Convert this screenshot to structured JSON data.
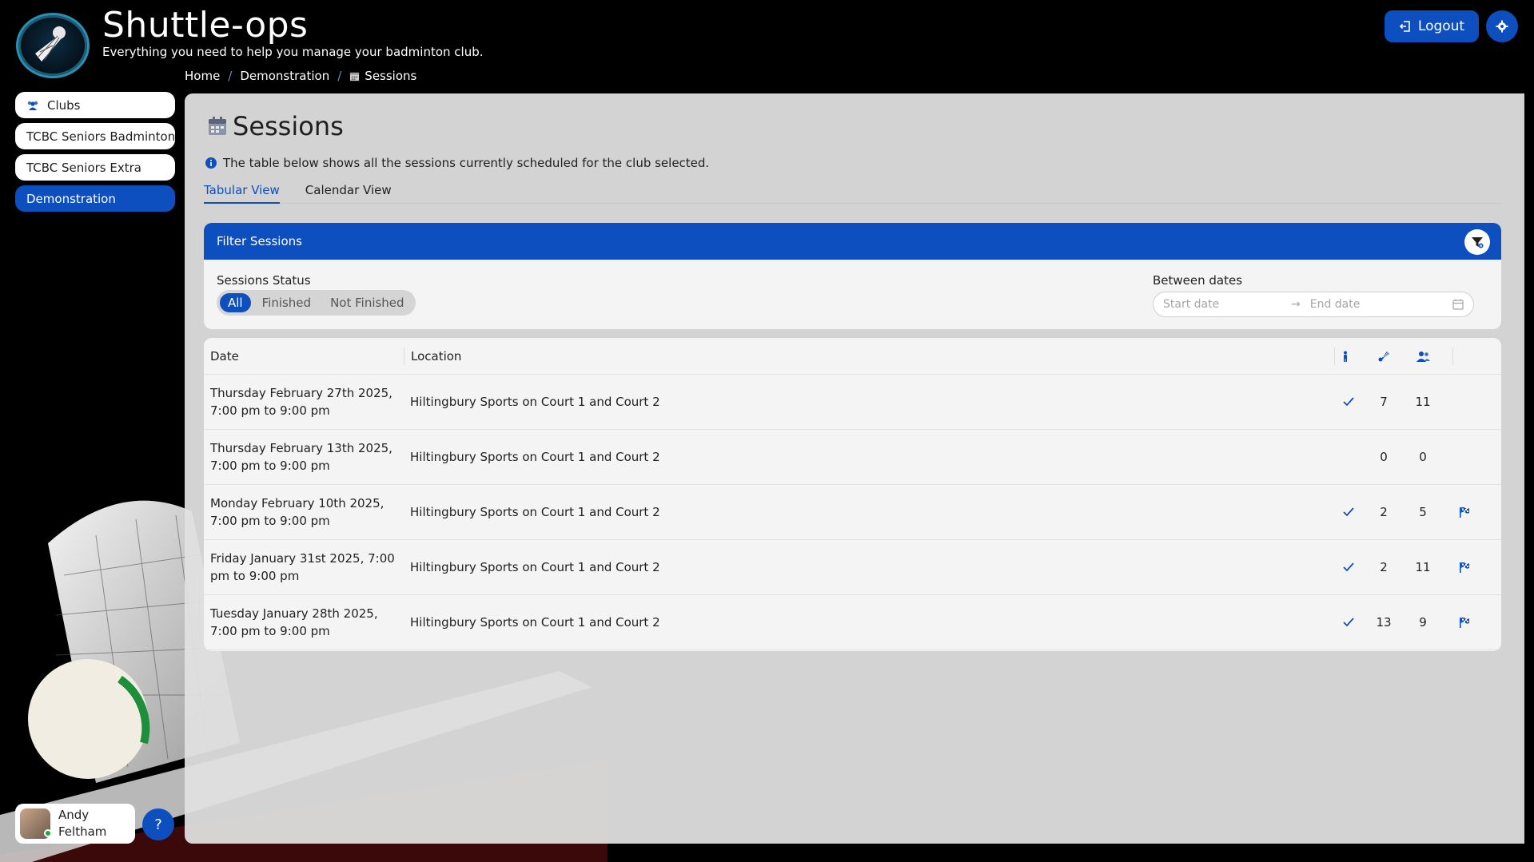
{
  "app": {
    "title": "Shuttle-ops",
    "subtitle": "Everything you need to help you manage your badminton club."
  },
  "breadcrumb": {
    "home": "Home",
    "club": "Demonstration",
    "current": "Sessions"
  },
  "header": {
    "logout_label": "Logout"
  },
  "sidebar": {
    "items": [
      {
        "label": "Clubs",
        "active": false
      },
      {
        "label": "TCBC Seniors Badminton",
        "active": false
      },
      {
        "label": "TCBC Seniors Extra",
        "active": false
      },
      {
        "label": "Demonstration",
        "active": true
      }
    ]
  },
  "user": {
    "first_name": "Andy",
    "last_name": "Feltham",
    "status": "online"
  },
  "help": {
    "label": "?"
  },
  "page": {
    "title": "Sessions",
    "info": "The table below shows all the sessions currently scheduled for the club selected."
  },
  "tabs": [
    {
      "label": "Tabular View",
      "active": true
    },
    {
      "label": "Calendar View",
      "active": false
    }
  ],
  "filter": {
    "title": "Filter Sessions",
    "status_label": "Sessions Status",
    "status_options": [
      "All",
      "Finished",
      "Not Finished"
    ],
    "status_selected": "All",
    "dates_label": "Between dates",
    "start_placeholder": "Start date",
    "end_placeholder": "End date"
  },
  "table": {
    "columns": {
      "date": "Date",
      "location": "Location"
    },
    "rows": [
      {
        "date": "Thursday February 27th 2025, 7:00 pm to 9:00 pm",
        "location": "Hiltingbury Sports on Court 1 and Court 2",
        "done": true,
        "count1": "7",
        "count2": "11",
        "flag": false
      },
      {
        "date": "Thursday February 13th 2025, 7:00 pm to 9:00 pm",
        "location": "Hiltingbury Sports on Court 1 and Court 2",
        "done": false,
        "count1": "0",
        "count2": "0",
        "flag": false
      },
      {
        "date": "Monday February 10th 2025, 7:00 pm to 9:00 pm",
        "location": "Hiltingbury Sports on Court 1 and Court 2",
        "done": true,
        "count1": "2",
        "count2": "5",
        "flag": true
      },
      {
        "date": "Friday January 31st 2025, 7:00 pm to 9:00 pm",
        "location": "Hiltingbury Sports on Court 1 and Court 2",
        "done": true,
        "count1": "2",
        "count2": "11",
        "flag": true
      },
      {
        "date": "Tuesday January 28th 2025, 7:00 pm to 9:00 pm",
        "location": "Hiltingbury Sports on Court 1 and Court 2",
        "done": true,
        "count1": "13",
        "count2": "9",
        "flag": true
      }
    ]
  },
  "colors": {
    "accent": "#0d4fbf",
    "background": "#000000",
    "panel": "#e0e0e0",
    "online": "#1bab3c"
  },
  "icons": {
    "logo": "shuttlecock-logo",
    "logout": "logout-icon",
    "settings": "gear-icon",
    "clubs": "people-icon",
    "sessions": "calendar-icon",
    "info": "info-icon",
    "filter_clear": "filter-clear-icon",
    "calendar": "calendar-icon",
    "col_done": "person-icon",
    "col_shuttle": "shuttlecock-icon",
    "col_players": "players-icon",
    "done": "check-icon",
    "flag": "flag-icon"
  }
}
